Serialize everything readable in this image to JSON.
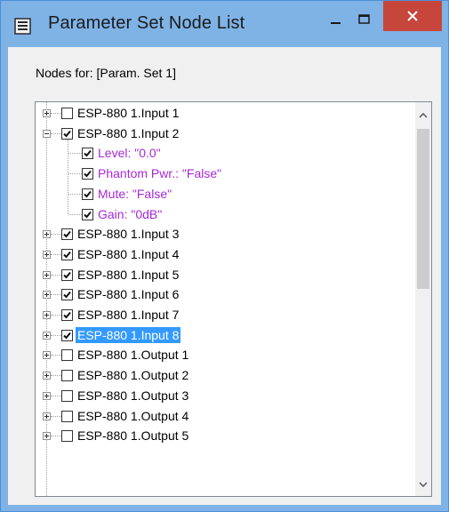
{
  "window": {
    "title": "Parameter Set Node List",
    "app_icon": "list-window-icon",
    "controls": {
      "minimize": "minimize-icon",
      "maximize": "maximize-icon",
      "close": "close-icon"
    }
  },
  "nodes_label": "Nodes for: [Param. Set 1]",
  "tree": {
    "items": [
      {
        "label": "ESP-880 1.Input 1",
        "checked": false,
        "expanded": false
      },
      {
        "label": "ESP-880 1.Input 2",
        "checked": true,
        "expanded": true
      },
      {
        "label": "Level: \"0.0\"",
        "checked": true,
        "child": true
      },
      {
        "label": "Phantom Pwr.: \"False\"",
        "checked": true,
        "child": true
      },
      {
        "label": "Mute: \"False\"",
        "checked": true,
        "child": true
      },
      {
        "label": "Gain: \"0dB\"",
        "checked": true,
        "child": true
      },
      {
        "label": "ESP-880 1.Input 3",
        "checked": true,
        "expanded": false
      },
      {
        "label": "ESP-880 1.Input 4",
        "checked": true,
        "expanded": false
      },
      {
        "label": "ESP-880 1.Input 5",
        "checked": true,
        "expanded": false
      },
      {
        "label": "ESP-880 1.Input 6",
        "checked": true,
        "expanded": false
      },
      {
        "label": "ESP-880 1.Input 7",
        "checked": true,
        "expanded": false
      },
      {
        "label": "ESP-880 1.Input 8",
        "checked": true,
        "expanded": false,
        "selected": true
      },
      {
        "label": "ESP-880 1.Output 1",
        "checked": false,
        "expanded": false
      },
      {
        "label": "ESP-880 1.Output 2",
        "checked": false,
        "expanded": false
      },
      {
        "label": "ESP-880 1.Output 3",
        "checked": false,
        "expanded": false
      },
      {
        "label": "ESP-880 1.Output 4",
        "checked": false,
        "expanded": false
      },
      {
        "label": "ESP-880 1.Output 5",
        "checked": false,
        "expanded": false
      }
    ]
  },
  "colors": {
    "param_text": "#a52ad6",
    "selection": "#3399ff",
    "close_button": "#c7463c",
    "frame": "#7fb3e6"
  }
}
